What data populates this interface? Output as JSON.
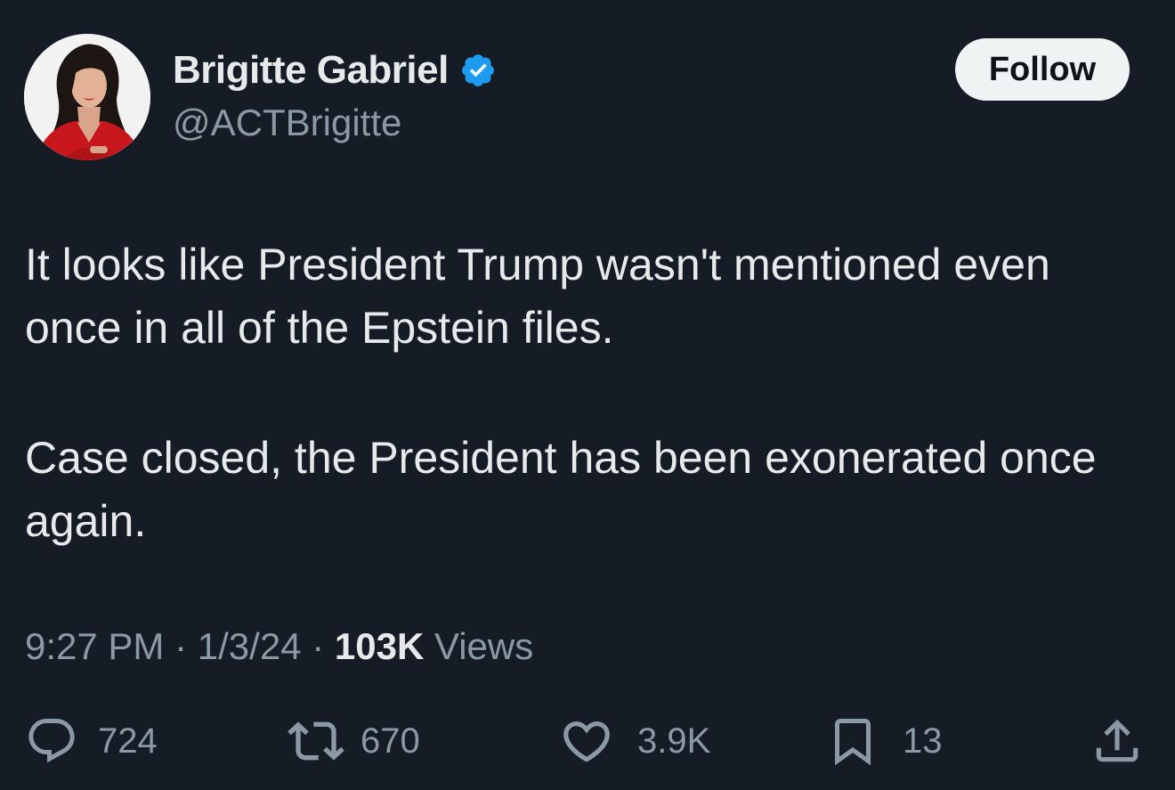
{
  "author": {
    "display_name": "Brigitte Gabriel",
    "handle": "@ACTBrigitte",
    "verified": true,
    "verified_color": "#1d9bf0"
  },
  "follow_label": "Follow",
  "tweet": {
    "paragraphs": [
      "It looks like President Trump wasn't mentioned even once in all of the Epstein files.",
      "Case closed, the President has been exonerated once again."
    ]
  },
  "meta": {
    "time": "9:27 PM",
    "separator": "·",
    "date": "1/3/24",
    "views_count": "103K",
    "views_label": "Views"
  },
  "actions": {
    "replies": "724",
    "retweets": "670",
    "likes": "3.9K",
    "bookmarks": "13"
  },
  "icons": {
    "reply": "reply-icon",
    "retweet": "retweet-icon",
    "like": "heart-icon",
    "bookmark": "bookmark-icon",
    "share": "share-icon"
  },
  "colors": {
    "background": "#151c26",
    "text": "#e7e9ea",
    "secondary_text": "#8b98a5",
    "follow_button_bg": "#eff3f4"
  }
}
